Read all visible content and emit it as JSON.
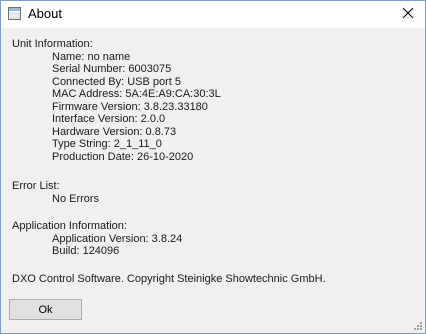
{
  "window": {
    "title": "About",
    "icon": "app-window-icon",
    "close_icon": "close-icon"
  },
  "unit_information": {
    "header": "Unit Information:",
    "name": "Name: no name",
    "serial_number": "Serial Number: 6003075",
    "connected_by": "Connected By: USB port 5",
    "mac_address": "MAC Address: 5A:4E:A9:CA:30:3L",
    "firmware_version": "Firmware Version: 3.8.23.33180",
    "interface_version": "Interface Version: 2.0.0",
    "hardware_version": "Hardware Version: 0.8.73",
    "type_string": "Type String: 2_1_11_0",
    "production_date": "Production Date: 26-10-2020"
  },
  "error_list": {
    "header": "Error List:",
    "value": "No Errors"
  },
  "application_information": {
    "header": "Application Information:",
    "application_version": "Application Version: 3.8.24",
    "build": "Build: 124096"
  },
  "copyright": "DXO Control Software. Copyright Steinigke Showtechnic GmbH.",
  "buttons": {
    "ok_label": "Ok"
  }
}
